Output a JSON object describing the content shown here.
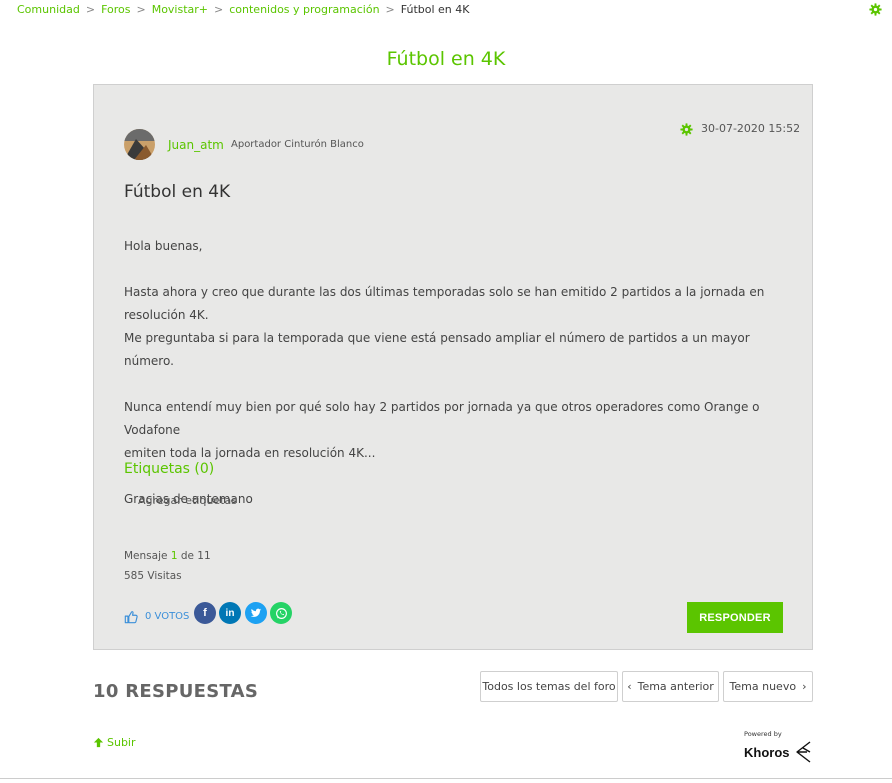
{
  "breadcrumb": {
    "items": [
      "Comunidad",
      "Foros",
      "Movistar+",
      "contenidos y programación"
    ],
    "separator": ">",
    "current": "Fútbol en 4K"
  },
  "page": {
    "title": "Fútbol en 4K"
  },
  "post": {
    "author": "Juan_atm",
    "rank": "Aportador Cinturón Blanco",
    "date": "30-07-2020 15:52",
    "subject": "Fútbol en 4K",
    "body": {
      "p1": "Hola buenas,",
      "p2a": "Hasta ahora y creo que durante las dos últimas temporadas solo se han emitido 2 partidos a la jornada en resolución 4K.",
      "p2b": "Me preguntaba si para la temporada que viene está pensado ampliar el número de partidos a un mayor número.",
      "p3a": "Nunca entendí muy bien por qué solo hay 2 partidos por jornada ya que otros operadores como Orange o Vodafone",
      "p3b": "emiten toda la jornada en resolución 4K...",
      "p4": "Gracias de antemano"
    },
    "tags_heading": "Etiquetas (0)",
    "tags_add": "Agregar etiquetas",
    "message_prefix": "Mensaje",
    "message_number": "1",
    "message_suffix": "de 11",
    "views": "585 Visitas",
    "votes": "0 VOTOS",
    "share": {
      "facebook": "f",
      "linkedin": "in",
      "twitter": "t",
      "whatsapp": "w"
    },
    "reply_label": "RESPONDER"
  },
  "replies": {
    "count_label": "10 RESPUESTAS"
  },
  "navigation": {
    "all_topics": "Todos los temas del foro",
    "prev_topic": "Tema anterior",
    "next_topic": "Tema nuevo"
  },
  "footer": {
    "up_label": "Subir",
    "powered_by": "Powered by",
    "brand": "Khoros"
  },
  "colors": {
    "accent": "#5bc500",
    "card_bg": "#e8e8e7",
    "vote_blue": "#3b8fd9"
  }
}
